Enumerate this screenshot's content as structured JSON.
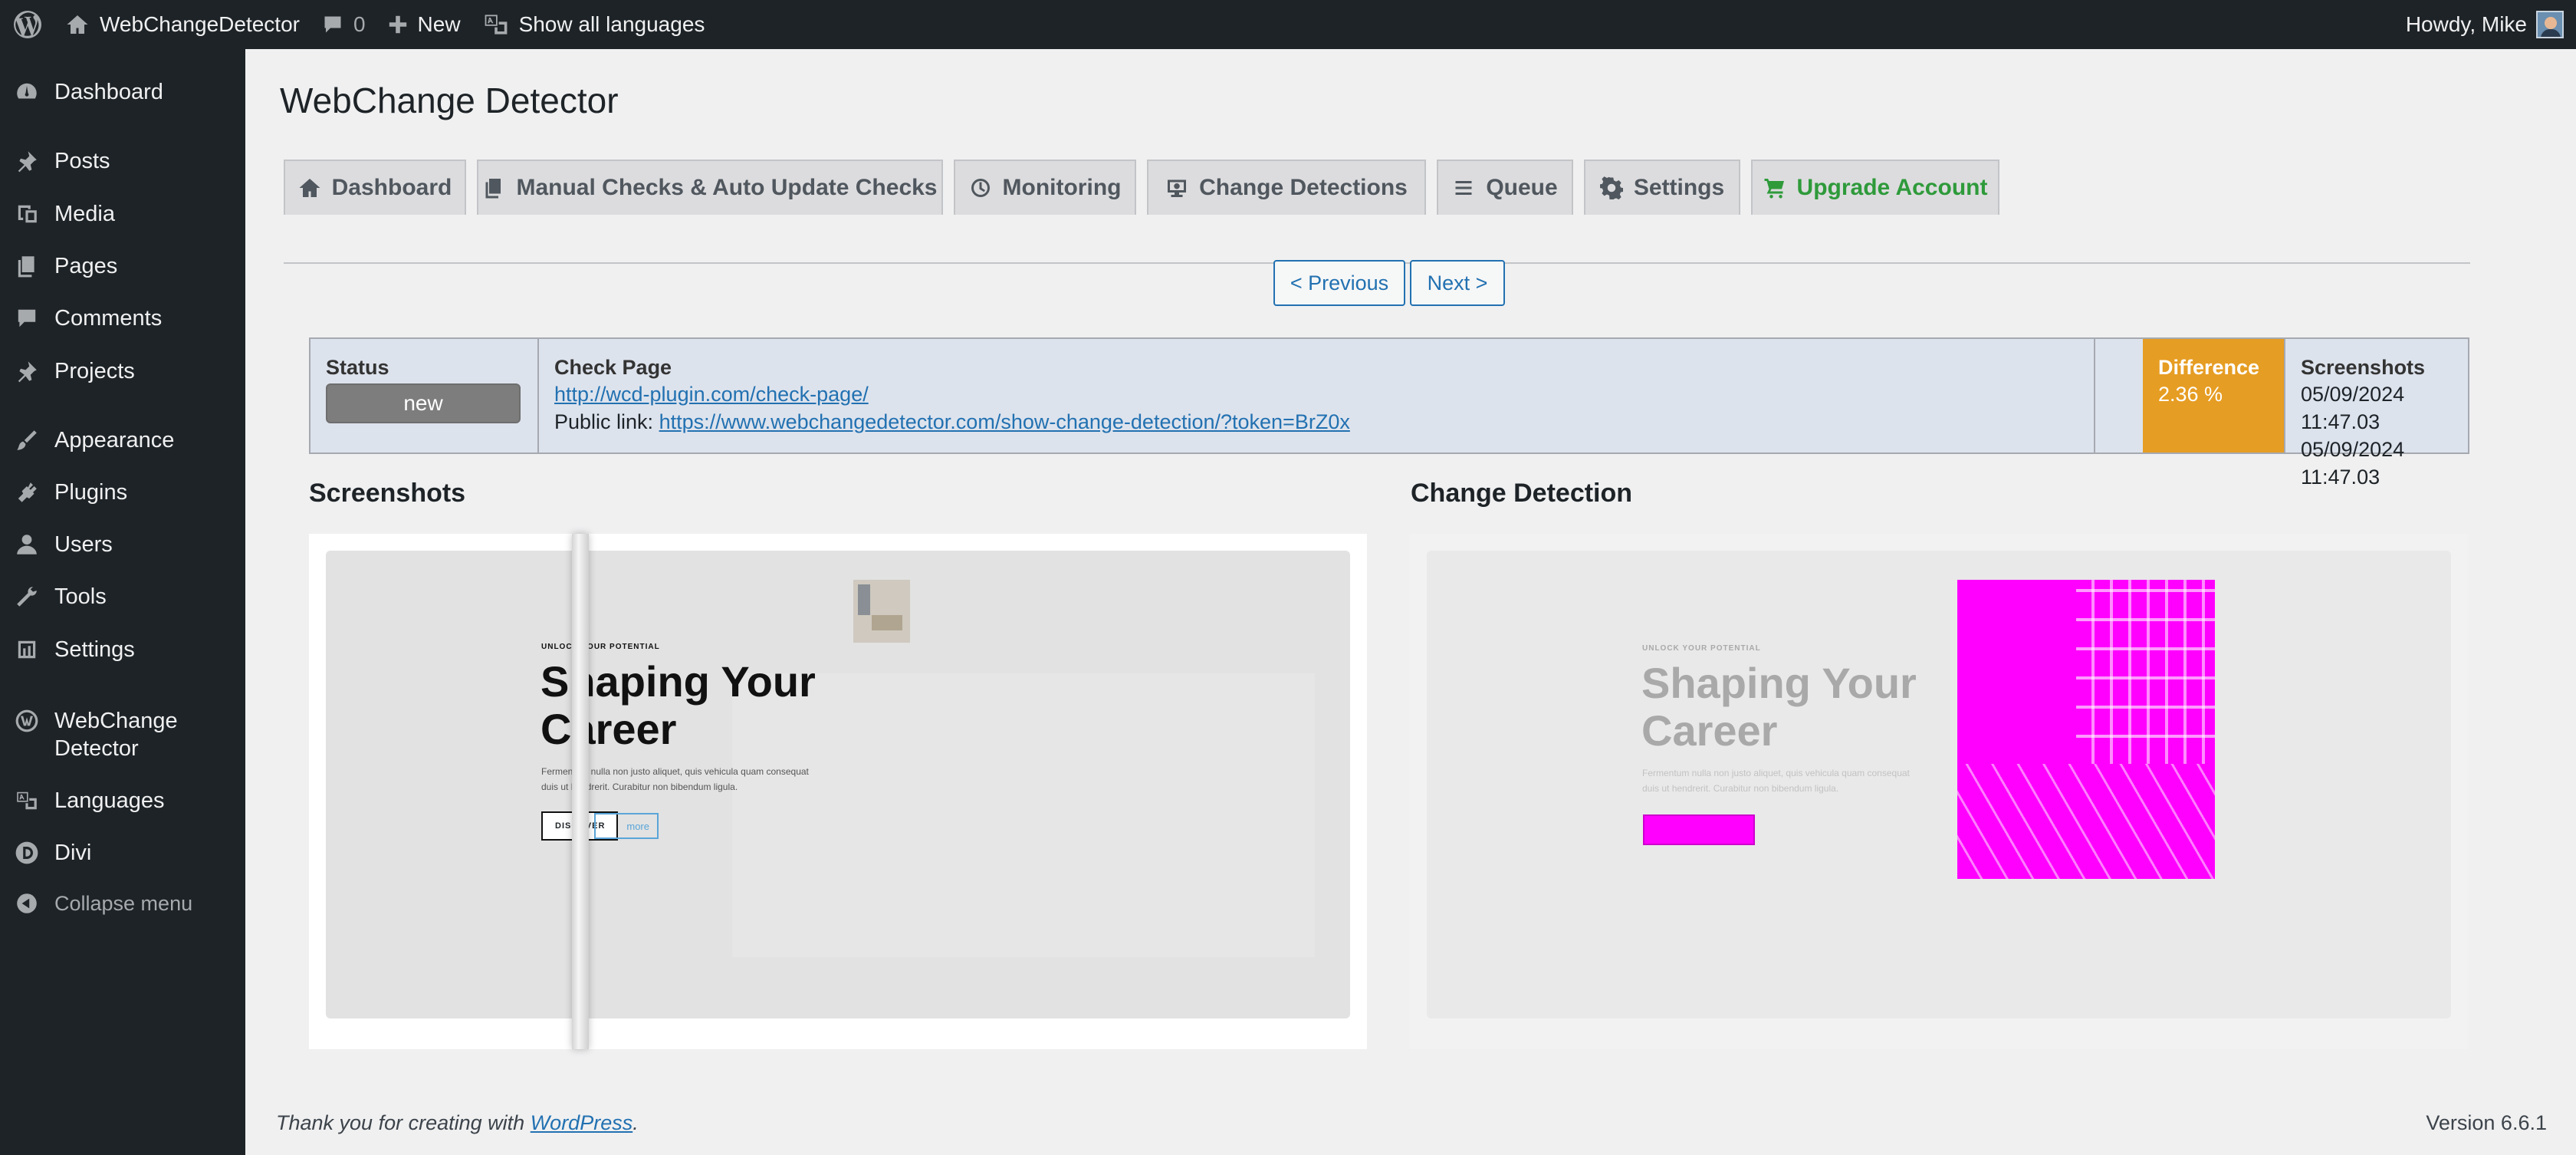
{
  "admin_bar": {
    "site_name": "WebChangeDetector",
    "comments_count": "0",
    "new_label": "New",
    "languages_label": "Show all languages",
    "greeting": "Howdy, Mike"
  },
  "sidebar": {
    "items": [
      {
        "label": "Dashboard",
        "icon": "dashboard-icon"
      },
      {
        "label": "Posts",
        "icon": "pin-icon"
      },
      {
        "label": "Media",
        "icon": "media-icon"
      },
      {
        "label": "Pages",
        "icon": "pages-icon"
      },
      {
        "label": "Comments",
        "icon": "comment-icon"
      },
      {
        "label": "Projects",
        "icon": "pin-icon"
      },
      {
        "label": "Appearance",
        "icon": "brush-icon"
      },
      {
        "label": "Plugins",
        "icon": "plug-icon"
      },
      {
        "label": "Users",
        "icon": "user-icon"
      },
      {
        "label": "Tools",
        "icon": "wrench-icon"
      },
      {
        "label": "Settings",
        "icon": "settings-icon"
      },
      {
        "label": "WebChange",
        "label2": "Detector",
        "icon": "wcd-icon"
      },
      {
        "label": "Languages",
        "icon": "translation-icon"
      },
      {
        "label": "Divi",
        "icon": "divi-icon"
      },
      {
        "label": "Collapse menu",
        "icon": "collapse-icon"
      }
    ]
  },
  "page": {
    "title": "WebChange Detector",
    "tabs": [
      {
        "label": "Dashboard",
        "icon": "home-icon"
      },
      {
        "label": "Manual Checks & Auto Update Checks",
        "icon": "copy-icon"
      },
      {
        "label": "Monitoring",
        "icon": "clock-icon"
      },
      {
        "label": "Change Detections",
        "icon": "screen-icon"
      },
      {
        "label": "Queue",
        "icon": "list-icon"
      },
      {
        "label": "Settings",
        "icon": "gear-icon"
      },
      {
        "label": "Upgrade Account",
        "icon": "cart-icon"
      }
    ],
    "pager": {
      "previous": "< Previous",
      "next": "Next >"
    }
  },
  "detail": {
    "status_label": "Status",
    "status_value": "new",
    "check_page_label": "Check Page",
    "check_page_url": "http://wcd-plugin.com/check-page/",
    "public_link_label": "Public link:",
    "public_link_url": "https://www.webchangedetector.com/show-change-detection/?token=BrZ0x",
    "difference_label": "Difference",
    "difference_value": "2.36 %",
    "screenshots_label": "Screenshots",
    "screenshot_date_1": "05/09/2024 11:47.03",
    "screenshot_date_2": "05/09/2024 11:47.03",
    "colors": {
      "difference_bg": "#e69d23",
      "highlight": "#ff00ff"
    }
  },
  "sections": {
    "screenshots_title": "Screenshots",
    "change_detection_title": "Change Detection"
  },
  "preview": {
    "eyebrow": "UNLOCK YOUR POTENTIAL",
    "heading_line1": "Shaping Your",
    "heading_line2": "Career",
    "body_line1": "Fermentum nulla non justo aliquet, quis vehicula quam consequat",
    "body_line2": "duis ut hendrerit. Curabitur non bibendum ligula.",
    "button": "DISCOVER",
    "more": "more"
  },
  "footer": {
    "text": "Thank you for creating with",
    "link": "WordPress",
    "version": "Version 6.6.1"
  }
}
